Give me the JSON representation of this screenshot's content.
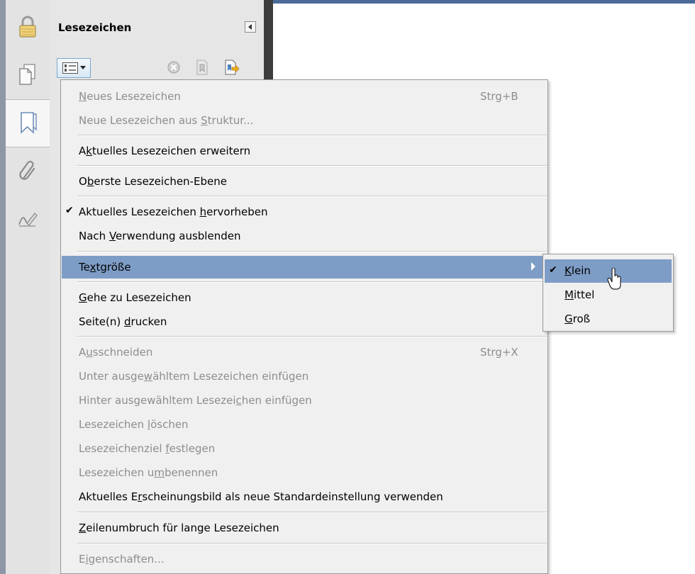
{
  "panel": {
    "title": "Lesezeichen"
  },
  "rail": {
    "tools": [
      {
        "icon": "lock-icon"
      },
      {
        "icon": "pages-icon"
      },
      {
        "icon": "bookmark-icon",
        "active": true
      },
      {
        "icon": "paperclip-icon"
      },
      {
        "icon": "signature-icon"
      }
    ]
  },
  "toolbar": {
    "options_icon": "options-menu-icon",
    "delete_icon": "delete-bookmark-icon",
    "new_bookmark_icon": "new-bookmark-icon",
    "expand_icon": "expand-bookmark-icon"
  },
  "menu": {
    "items": [
      {
        "pre": "",
        "u": "N",
        "post": "eues Lesezeichen",
        "shortcut": "Strg+B",
        "enabled": false
      },
      {
        "pre": "Neue Lesezeichen aus ",
        "u": "S",
        "post": "truktur...",
        "enabled": false
      },
      {
        "pre": "A",
        "u": "k",
        "post": "tuelles Lesezeichen erweitern",
        "enabled": true
      },
      {
        "pre": "O",
        "u": "b",
        "post": "erste Lesezeichen-Ebene",
        "enabled": true
      },
      {
        "pre": "Aktuelles Lesezeichen ",
        "u": "h",
        "post": "ervorheben",
        "enabled": true,
        "checked": true
      },
      {
        "pre": "Nach ",
        "u": "V",
        "post": "erwendung ausblenden",
        "enabled": true
      },
      {
        "pre": "Te",
        "u": "x",
        "post": "tgröße",
        "enabled": true,
        "highlighted": true,
        "submenu": true
      },
      {
        "pre": "",
        "u": "G",
        "post": "ehe zu Lesezeichen",
        "enabled": true
      },
      {
        "pre": "Seite(n) ",
        "u": "d",
        "post": "rucken",
        "enabled": true
      },
      {
        "pre": "A",
        "u": "u",
        "post": "sschneiden",
        "shortcut": "Strg+X",
        "enabled": false
      },
      {
        "pre": "Unter ausge",
        "u": "w",
        "post": "ähltem Lesezeichen einfügen",
        "enabled": false
      },
      {
        "pre": "Hinter ausgewähltem Lesezei",
        "u": "c",
        "post": "hen einfügen",
        "enabled": false
      },
      {
        "pre": "Lesezeichen ",
        "u": "l",
        "post": "öschen",
        "enabled": false
      },
      {
        "pre": "Lesezeichenziel ",
        "u": "f",
        "post": "estlegen",
        "enabled": false
      },
      {
        "pre": "Lesezeichen u",
        "u": "m",
        "post": "benennen",
        "enabled": false
      },
      {
        "pre": "Aktuelles E",
        "u": "r",
        "post": "scheinungsbild als neue Standardeinstellung verwenden",
        "enabled": true
      },
      {
        "pre": "",
        "u": "Z",
        "post": "eilenumbruch für lange Lesezeichen",
        "enabled": true
      },
      {
        "pre": "E",
        "u": "i",
        "post": "genschaften...",
        "enabled": false
      }
    ]
  },
  "submenu": {
    "items": [
      {
        "pre": "",
        "u": "K",
        "post": "lein",
        "checked": true,
        "highlighted": true
      },
      {
        "pre": "",
        "u": "M",
        "post": "ittel"
      },
      {
        "pre": "",
        "u": "G",
        "post": "roß"
      }
    ]
  },
  "colors": {
    "highlight": "#7e9dc6",
    "menu_bg": "#f0f0f0",
    "disabled_text": "#8d8d8d"
  }
}
